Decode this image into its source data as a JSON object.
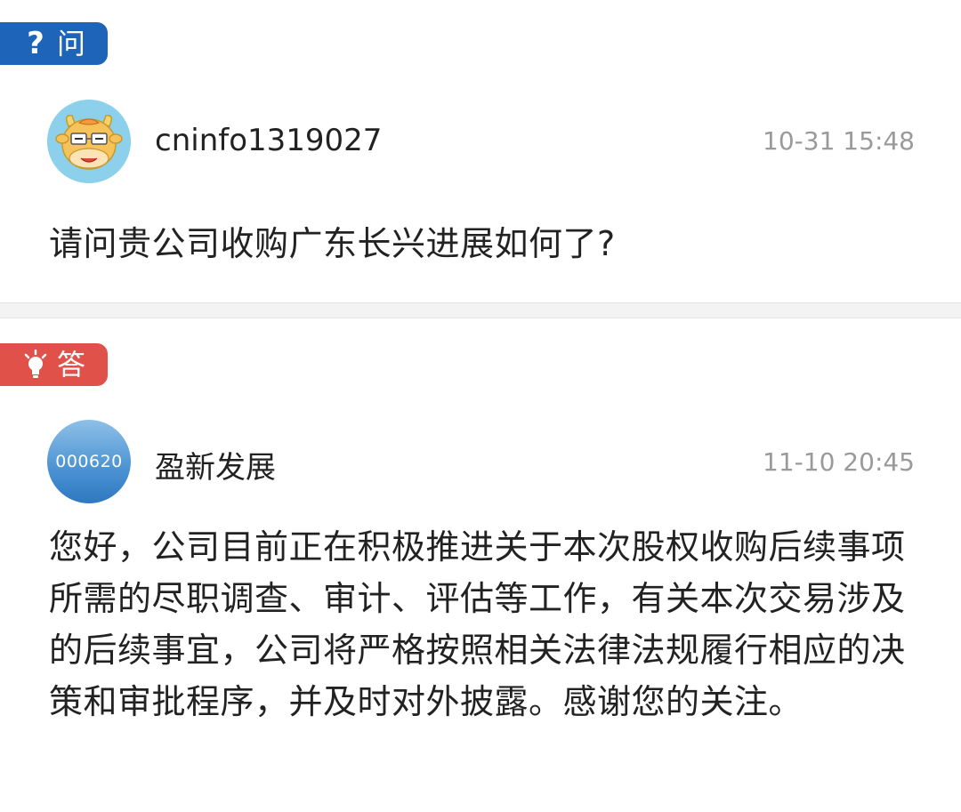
{
  "question": {
    "tag_label": "问",
    "tag_icon": "question-mark-icon",
    "tag_color": "#1e64b8",
    "avatar_icon": "cartoon-cow-avatar",
    "username": "cninfo1319027",
    "timestamp": "10-31 15:48",
    "text": "请问贵公司收购广东长兴进展如何了?"
  },
  "answer": {
    "tag_label": "答",
    "tag_icon": "lightbulb-icon",
    "tag_color": "#e0514a",
    "avatar_text": "000620",
    "username": "盈新发展",
    "timestamp": "11-10 20:45",
    "text": "您好，公司目前正在积极推进关于本次股权收购后续事项所需的尽职调查、审计、评估等工作，有关本次交易涉及的后续事宜，公司将严格按照相关法律法规履行相应的决策和审批程序，并及时对外披露。感谢您的关注。"
  }
}
